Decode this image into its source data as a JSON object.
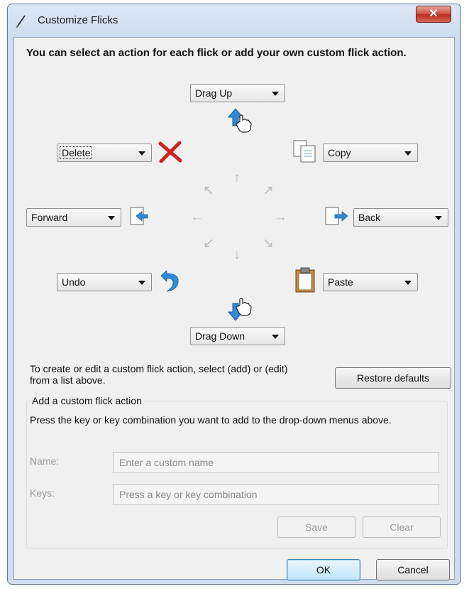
{
  "window": {
    "title": "Customize Flicks",
    "close_glyph": "✕"
  },
  "heading": "You can select an action for each flick or add your own custom flick action.",
  "flicks": {
    "up": "Drag Up",
    "down": "Drag Down",
    "upper_left": "Delete",
    "upper_right": "Copy",
    "left": "Forward",
    "right": "Back",
    "lower_left": "Undo",
    "lower_right": "Paste"
  },
  "center_arrows": {
    "n": "↑",
    "s": "↓",
    "w": "←",
    "e": "→",
    "nw": "↖",
    "ne": "↗",
    "sw": "↙",
    "se": "↘"
  },
  "info_text": "To create or edit a custom flick action, select (add) or (edit) from a list above.",
  "restore_button": "Restore defaults",
  "custom_group": {
    "title": "Add a custom flick action",
    "instructions": "Press the key or key combination you want to add to the drop-down menus above.",
    "name_label": "Name:",
    "name_placeholder": "Enter a custom name",
    "keys_label": "Keys:",
    "keys_placeholder": "Press a key or key combination",
    "save_button": "Save",
    "clear_button": "Clear"
  },
  "footer": {
    "ok_button": "OK",
    "cancel_button": "Cancel"
  },
  "colors": {
    "accent": "#2e8bd8",
    "delete": "#d0211a",
    "title_bar": "#cddcef"
  }
}
